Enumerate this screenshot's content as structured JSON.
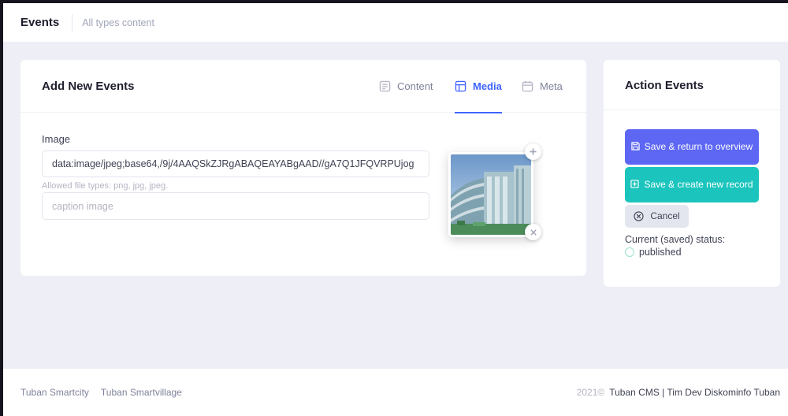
{
  "header": {
    "title": "Events",
    "subtitle": "All types content"
  },
  "main": {
    "title": "Add New Events",
    "tabs": [
      {
        "label": "Content",
        "icon": "content-icon"
      },
      {
        "label": "Media",
        "icon": "media-icon",
        "active": true
      },
      {
        "label": "Meta",
        "icon": "meta-icon"
      }
    ],
    "image_label": "Image",
    "image_value": "data:image/jpeg;base64,/9j/4AAQSkZJRgABAQEAYABgAAD//gA7Q1JFQVRPUjog",
    "hint": "Allowed file types: png, jpg, jpeg.",
    "caption_placeholder": "caption image"
  },
  "side": {
    "title": "Action Events",
    "save_return_label": "Save & return to overview",
    "save_create_label": "Save & create new record",
    "cancel_label": "Cancel",
    "status_label": "Current (saved) status:",
    "status_value": "published"
  },
  "footer": {
    "links": [
      "Tuban Smartcity",
      "Tuban Smartvillage"
    ],
    "year": "2021©",
    "credit": "Tuban CMS | Tim Dev Diskominfo Tuban"
  },
  "colors": {
    "primary": "#5d67f4",
    "success": "#1bc5bd",
    "tab_active": "#3e64ff",
    "background": "#eeeef6"
  }
}
